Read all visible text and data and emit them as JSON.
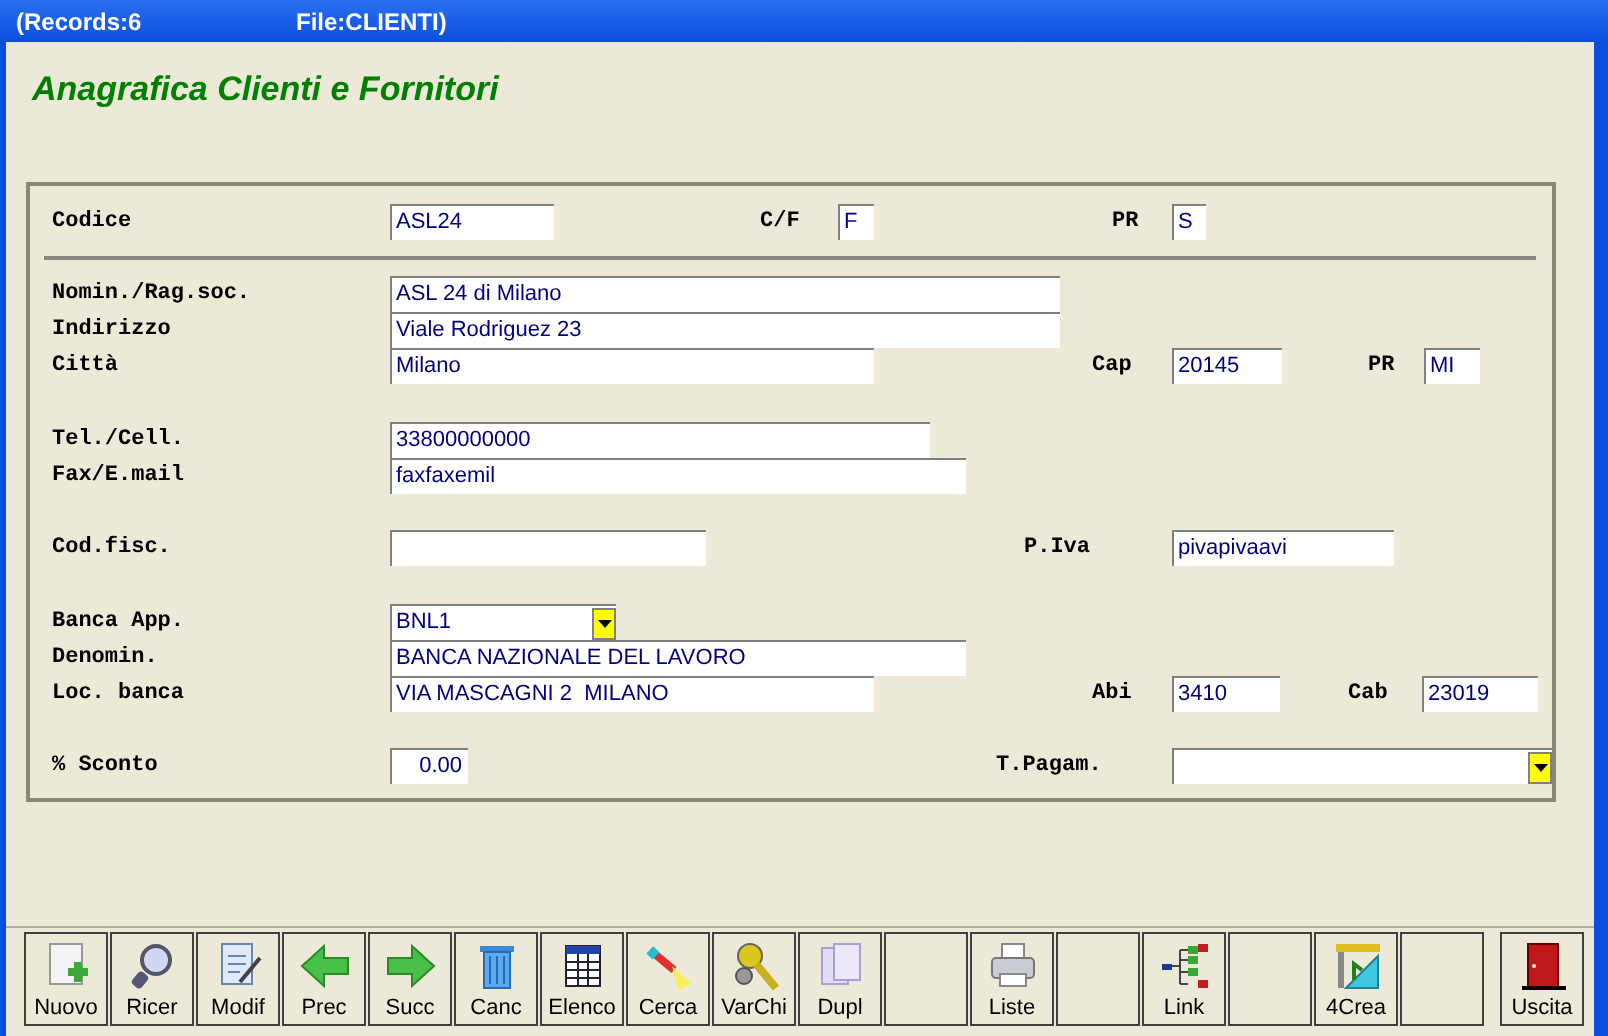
{
  "title_bar": {
    "records": "(Records:6",
    "file": "File:CLIENTI)"
  },
  "heading": "Anagrafica Clienti e Fornitori",
  "form": {
    "rows": [
      {
        "items": [
          {
            "label": "Codice",
            "value": "ASL24",
            "kind": "text"
          },
          {
            "label": "C/F",
            "value": "F",
            "kind": "text"
          },
          {
            "label": "PR",
            "value": "S",
            "kind": "text"
          }
        ]
      },
      {
        "items": [
          {
            "label": "Nomin./Rag.soc.",
            "value": "ASL 24 di Milano",
            "kind": "text"
          }
        ]
      },
      {
        "items": [
          {
            "label": "Indirizzo",
            "value": "Viale Rodriguez 23",
            "kind": "text"
          }
        ]
      },
      {
        "items": [
          {
            "label": "Città",
            "value": "Milano",
            "kind": "text"
          },
          {
            "label": "Cap",
            "value": "20145",
            "kind": "text"
          },
          {
            "label": "PR",
            "value": "MI",
            "kind": "text"
          }
        ]
      },
      {
        "items": [
          {
            "label": "Tel./Cell.",
            "value": "33800000000",
            "kind": "text"
          }
        ]
      },
      {
        "items": [
          {
            "label": "Fax/E.mail",
            "value": "faxfaxemil",
            "kind": "text"
          }
        ]
      },
      {
        "items": [
          {
            "label": "Cod.fisc.",
            "kind": "text"
          },
          {
            "label": "P.Iva",
            "value": "pivapivaavi",
            "kind": "text"
          }
        ]
      },
      {
        "items": [
          {
            "label": "Banca App.",
            "value": "BNL1",
            "kind": "combo"
          }
        ]
      },
      {
        "items": [
          {
            "label": "Denomin.",
            "value": "BANCA NAZIONALE DEL LAVORO",
            "kind": "text"
          }
        ]
      },
      {
        "items": [
          {
            "label": "Loc. banca",
            "value": "VIA MASCAGNI 2  MILANO",
            "kind": "text"
          },
          {
            "label": "Abi",
            "value": "3410",
            "kind": "text"
          },
          {
            "label": "Cab",
            "value": "23019",
            "kind": "text"
          }
        ]
      },
      {
        "items": [
          {
            "label": "% Sconto",
            "value": "0.00",
            "kind": "number"
          },
          {
            "label": "T.Pagam.",
            "kind": "combo"
          }
        ]
      }
    ]
  },
  "toolbar": {
    "buttons": [
      {
        "label": "Nuovo",
        "kind": "button"
      },
      {
        "label": "Ricer",
        "kind": "button"
      },
      {
        "label": "Modif",
        "kind": "button"
      },
      {
        "label": "Prec",
        "kind": "button"
      },
      {
        "label": "Succ",
        "kind": "button"
      },
      {
        "label": "Canc",
        "kind": "button"
      },
      {
        "label": "Elenco",
        "kind": "button"
      },
      {
        "label": "Cerca",
        "kind": "button"
      },
      {
        "label": "VarChi",
        "kind": "button"
      },
      {
        "label": "Dupl",
        "kind": "button"
      },
      {
        "kind": "empty"
      },
      {
        "label": "Liste",
        "kind": "button"
      },
      {
        "kind": "empty"
      },
      {
        "label": "Link",
        "kind": "button"
      },
      {
        "kind": "empty"
      },
      {
        "label": "4Crea",
        "kind": "button"
      },
      {
        "kind": "empty"
      },
      {
        "label": "Uscita",
        "kind": "exit"
      }
    ]
  }
}
